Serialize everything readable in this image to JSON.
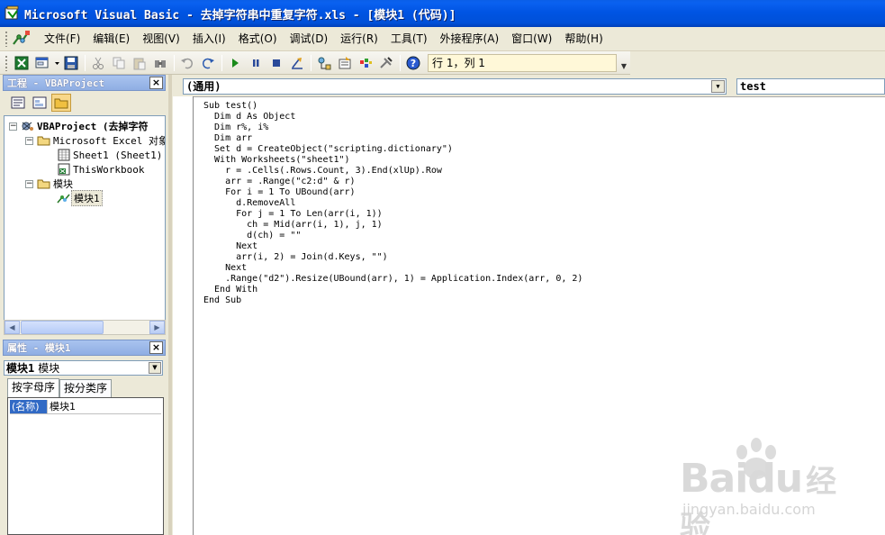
{
  "window": {
    "title": "Microsoft Visual Basic - 去掉字符串中重复字符.xls - [模块1 (代码)]"
  },
  "menu": {
    "items": [
      "文件(F)",
      "编辑(E)",
      "视图(V)",
      "插入(I)",
      "格式(O)",
      "调试(D)",
      "运行(R)",
      "工具(T)",
      "外接程序(A)",
      "窗口(W)",
      "帮助(H)"
    ]
  },
  "toolbar": {
    "status": "行 1，列 1"
  },
  "project_panel": {
    "title": "工程 - VBAProject",
    "tree": [
      {
        "label": "VBAProject (去掉字符",
        "toggle": "−"
      },
      {
        "label": "Microsoft Excel 对象",
        "toggle": "−"
      },
      {
        "label": "Sheet1 (Sheet1)"
      },
      {
        "label": "ThisWorkbook"
      },
      {
        "label": "模块",
        "toggle": "−"
      },
      {
        "label": "模块1"
      }
    ]
  },
  "properties_panel": {
    "title": "属性 - 模块1",
    "object_name": "模块1",
    "object_type": "模块",
    "tabs": [
      "按字母序",
      "按分类序"
    ],
    "rows": [
      {
        "key": "(名称)",
        "value": "模块1"
      }
    ]
  },
  "code_window": {
    "object_combo": "(通用)",
    "proc_combo": "test",
    "lines": [
      "Sub test()",
      "  Dim d As Object",
      "  Dim r%, i%",
      "  Dim arr",
      "  Set d = CreateObject(\"scripting.dictionary\")",
      "  With Worksheets(\"sheet1\")",
      "    r = .Cells(.Rows.Count, 3).End(xlUp).Row",
      "    arr = .Range(\"c2:d\" & r)",
      "    For i = 1 To UBound(arr)",
      "      d.RemoveAll",
      "      For j = 1 To Len(arr(i, 1))",
      "        ch = Mid(arr(i, 1), j, 1)",
      "        d(ch) = \"\"",
      "      Next",
      "      arr(i, 2) = Join(d.Keys, \"\")",
      "    Next",
      "    .Range(\"d2\").Resize(UBound(arr), 1) = Application.Index(arr, 0, 2)",
      "  End With",
      "End Sub"
    ]
  },
  "watermark": {
    "logo": "Bai",
    "logo2": "du",
    "logo_cn": "经验",
    "url": "jingyan.baidu.com"
  },
  "colors": {
    "title_bar": "#0054e3",
    "selection": "#316ac5",
    "panel_title": "#a9c3ef"
  }
}
